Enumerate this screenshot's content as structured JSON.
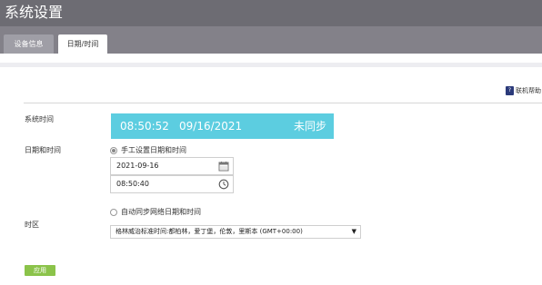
{
  "header": {
    "title": "系统设置"
  },
  "tabs": [
    {
      "label": "设备信息"
    },
    {
      "label": "日期/时间"
    }
  ],
  "help": {
    "label": "联机帮助"
  },
  "system_time": {
    "label": "系统时间",
    "time": "08:50:52",
    "date": "09/16/2021",
    "status": "未同步",
    "color": "#5ccde0"
  },
  "datetime": {
    "label": "日期和时间",
    "manual_option": "手工设置日期和时间",
    "date_value": "2021-09-16",
    "time_value": "08:50:40",
    "auto_option": "自动同步网络日期和时间"
  },
  "timezone": {
    "label": "时区",
    "selected": "格林威治标准时间:都柏林，爱丁堡，伦敦，里斯本 (GMT+00:00)"
  },
  "apply_button": {
    "label": "应用",
    "color": "#8bc34a"
  }
}
